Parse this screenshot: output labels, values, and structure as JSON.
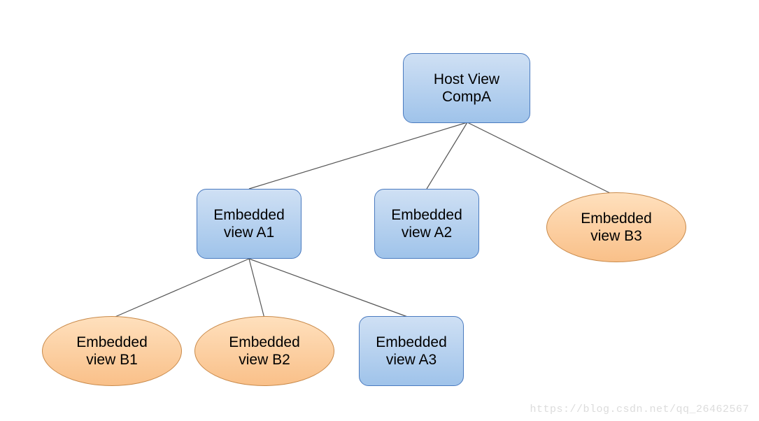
{
  "nodes": {
    "root": {
      "line1": "Host View",
      "line2": "CompA"
    },
    "a1": {
      "line1": "Embedded",
      "line2": "view A1"
    },
    "a2": {
      "line1": "Embedded",
      "line2": "view A2"
    },
    "b3": {
      "line1": "Embedded",
      "line2": "view B3"
    },
    "b1": {
      "line1": "Embedded",
      "line2": "view B1"
    },
    "b2": {
      "line1": "Embedded",
      "line2": "view B2"
    },
    "a3": {
      "line1": "Embedded",
      "line2": "view A3"
    }
  },
  "watermark": "https://blog.csdn.net/qq_26462567",
  "chart_data": {
    "type": "tree",
    "title": "",
    "root": "Host View CompA",
    "nodes": [
      {
        "id": "root",
        "label": "Host View CompA",
        "shape": "rounded-rect",
        "color": "blue"
      },
      {
        "id": "a1",
        "label": "Embedded view A1",
        "shape": "rounded-rect",
        "color": "blue"
      },
      {
        "id": "a2",
        "label": "Embedded view A2",
        "shape": "rounded-rect",
        "color": "blue"
      },
      {
        "id": "b3",
        "label": "Embedded view B3",
        "shape": "ellipse",
        "color": "orange"
      },
      {
        "id": "b1",
        "label": "Embedded view B1",
        "shape": "ellipse",
        "color": "orange"
      },
      {
        "id": "b2",
        "label": "Embedded view B2",
        "shape": "ellipse",
        "color": "orange"
      },
      {
        "id": "a3",
        "label": "Embedded view A3",
        "shape": "rounded-rect",
        "color": "blue"
      }
    ],
    "edges": [
      {
        "from": "root",
        "to": "a1"
      },
      {
        "from": "root",
        "to": "a2"
      },
      {
        "from": "root",
        "to": "b3"
      },
      {
        "from": "a1",
        "to": "b1"
      },
      {
        "from": "a1",
        "to": "b2"
      },
      {
        "from": "a1",
        "to": "a3"
      }
    ]
  }
}
